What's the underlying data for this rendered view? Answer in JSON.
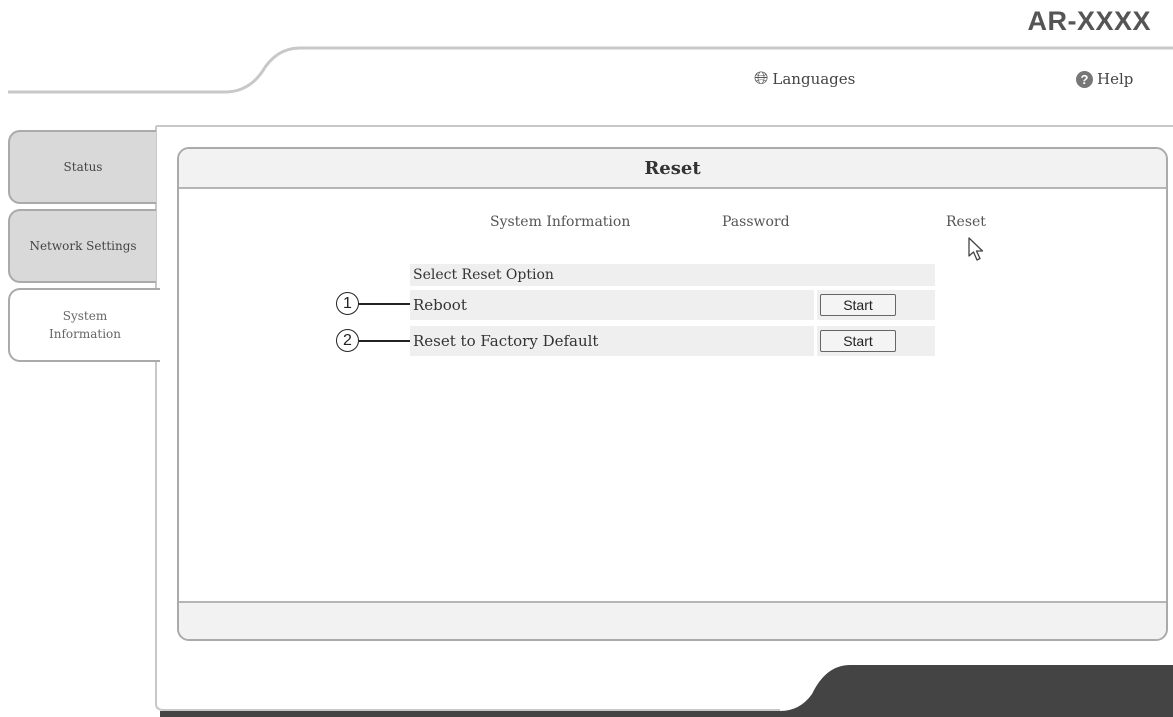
{
  "header": {
    "model": "AR-XXXX",
    "languages_label": "Languages",
    "help_label": "Help"
  },
  "sidebar": {
    "tabs": [
      {
        "label": "Status",
        "active": false
      },
      {
        "label": "Network Settings",
        "active": false
      },
      {
        "label": "System Information",
        "active": true
      }
    ]
  },
  "panel": {
    "title": "Reset",
    "subnav": [
      "System Information",
      "Password",
      "Reset"
    ],
    "options_header": "Select Reset Option",
    "options": [
      {
        "callout": "1",
        "label": "Reboot",
        "button": "Start"
      },
      {
        "callout": "2",
        "label": "Reset to Factory Default",
        "button": "Start"
      }
    ]
  },
  "icons": {
    "languages": "globe-icon",
    "help": "help-icon",
    "pointer": "mouse-cursor-icon"
  }
}
